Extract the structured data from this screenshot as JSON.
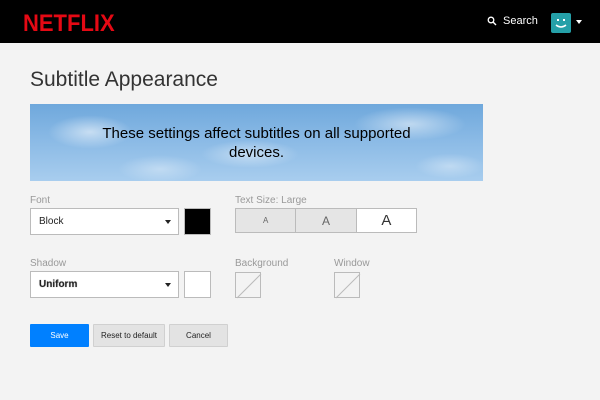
{
  "header": {
    "logo_text": "NETFLIX",
    "search_label": "Search",
    "brand_color": "#e50914"
  },
  "page": {
    "title": "Subtitle Appearance",
    "preview_text": "These settings affect subtitles on all supported devices."
  },
  "font": {
    "label": "Font",
    "value": "Block",
    "color": "#000000"
  },
  "text_size": {
    "label": "Text Size: Large",
    "options": [
      "A",
      "A",
      "A"
    ],
    "selected_index": 2
  },
  "shadow": {
    "label": "Shadow",
    "value": "Uniform",
    "color": "#ffffff"
  },
  "background": {
    "label": "Background"
  },
  "window": {
    "label": "Window"
  },
  "buttons": {
    "save": "Save",
    "reset": "Reset to default",
    "cancel": "Cancel"
  },
  "icons": [
    "search-icon",
    "avatar-icon",
    "chevron-down-icon"
  ]
}
